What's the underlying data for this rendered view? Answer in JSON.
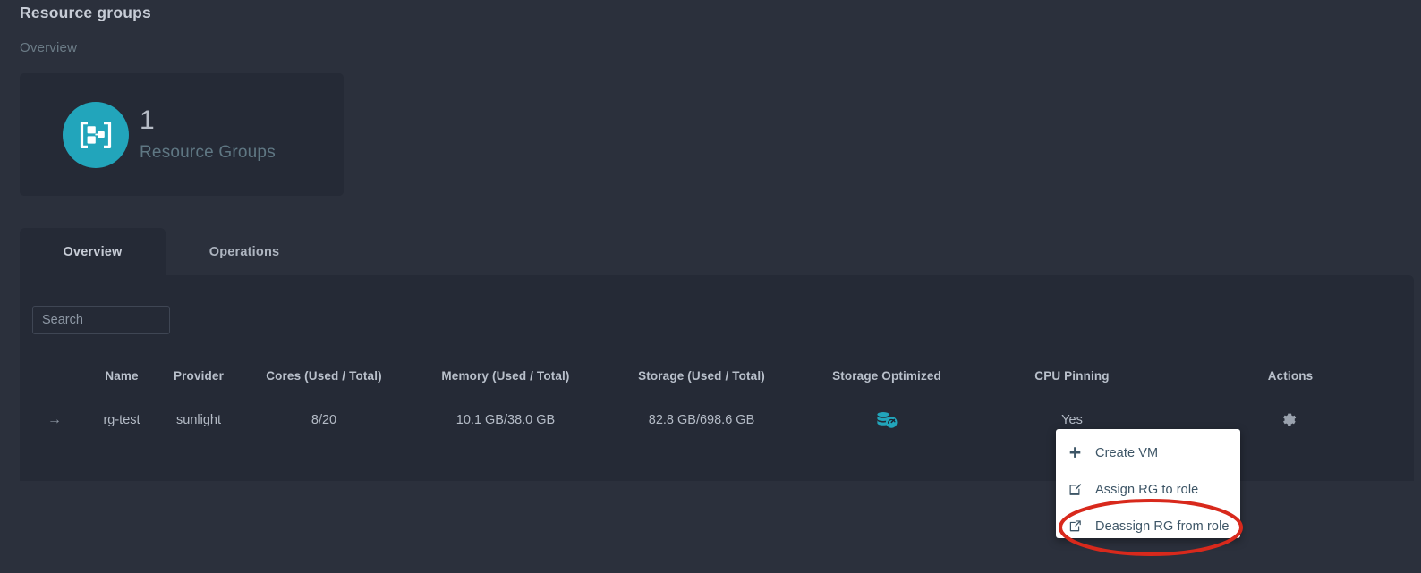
{
  "header": {
    "title": "Resource groups",
    "breadcrumb": "Overview"
  },
  "stat_card": {
    "count": "1",
    "label": "Resource Groups",
    "icon": "resource-group-icon",
    "icon_color": "#22a5bb"
  },
  "tabs": [
    {
      "label": "Overview",
      "active": true
    },
    {
      "label": "Operations",
      "active": false
    }
  ],
  "search": {
    "placeholder": "Search",
    "value": ""
  },
  "table": {
    "columns": [
      "",
      "Name",
      "Provider",
      "Cores (Used / Total)",
      "Memory (Used / Total)",
      "Storage (Used / Total)",
      "Storage Optimized",
      "CPU Pinning",
      "Actions"
    ],
    "rows": [
      {
        "expand_icon": "arrow-right-icon",
        "name": "rg-test",
        "provider": "sunlight",
        "cores": "8/20",
        "memory": "10.1 GB/38.0 GB",
        "storage": "82.8 GB/698.6 GB",
        "storage_optimized_icon": "storage-optimized-icon",
        "cpu_pinning": "Yes",
        "actions_icon": "gear-icon"
      }
    ]
  },
  "context_menu": {
    "items": [
      {
        "label": "Create VM",
        "icon": "plus-icon"
      },
      {
        "label": "Assign RG to role",
        "icon": "edit-square-icon"
      },
      {
        "label": "Deassign RG from role",
        "icon": "external-link-icon",
        "highlighted": true
      }
    ]
  },
  "annotation": {
    "shape": "ellipse",
    "color": "#d8291c",
    "targets": "Deassign RG from role"
  },
  "colors": {
    "page_background": "#2b303c",
    "panel_background": "#252a36",
    "accent_teal": "#22a5bb",
    "text_primary": "#c7ccd6",
    "text_muted": "#6b7b86",
    "menu_background": "#ffffff",
    "annotation_red": "#d8291c"
  }
}
